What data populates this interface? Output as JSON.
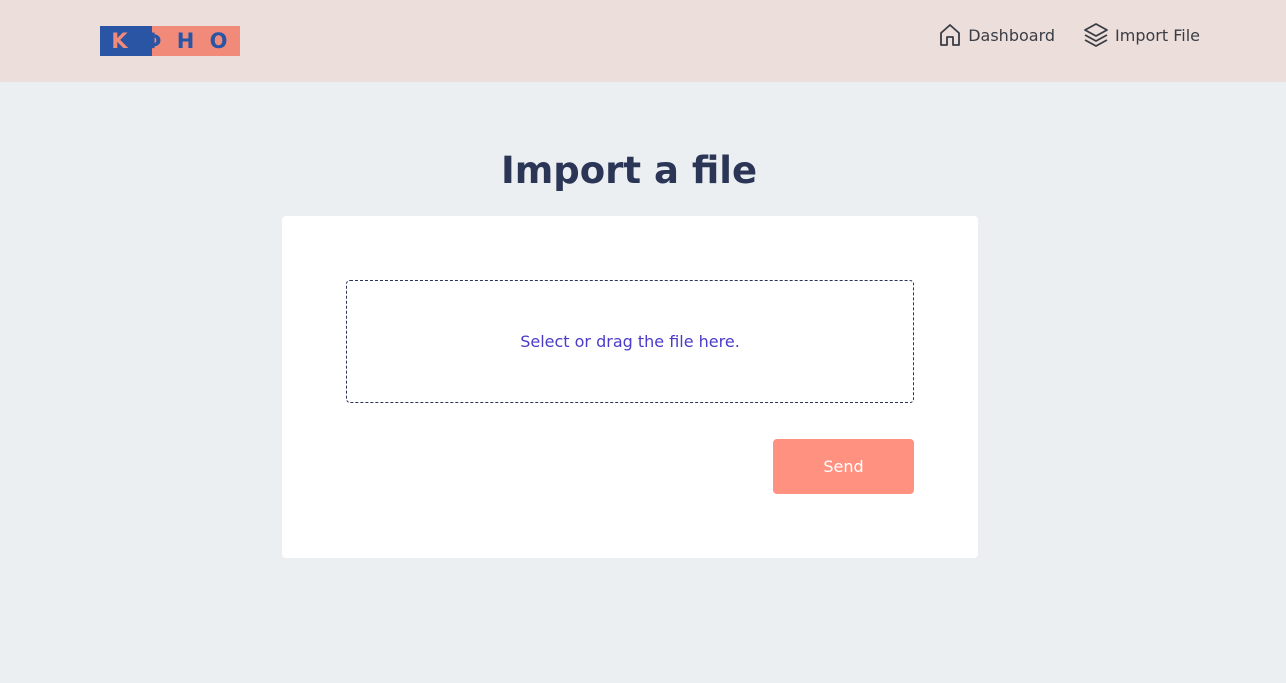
{
  "header": {
    "logo": {
      "letters": [
        "K",
        "Φ",
        "H",
        "O"
      ],
      "colors": {
        "left_block": "#2a55a4",
        "right_block": "#f28a7a"
      }
    },
    "nav": [
      {
        "label": "Dashboard",
        "icon": "home-icon"
      },
      {
        "label": "Import File",
        "icon": "layers-icon"
      }
    ]
  },
  "main": {
    "title": "Import a file",
    "dropzone": {
      "label": "Select or drag the file here."
    },
    "send_label": "Send"
  },
  "colors": {
    "header_bg": "#ecdedb",
    "page_bg": "#ebeff2",
    "accent_text": "#4a3bc8",
    "send_button": "#ff9180"
  }
}
